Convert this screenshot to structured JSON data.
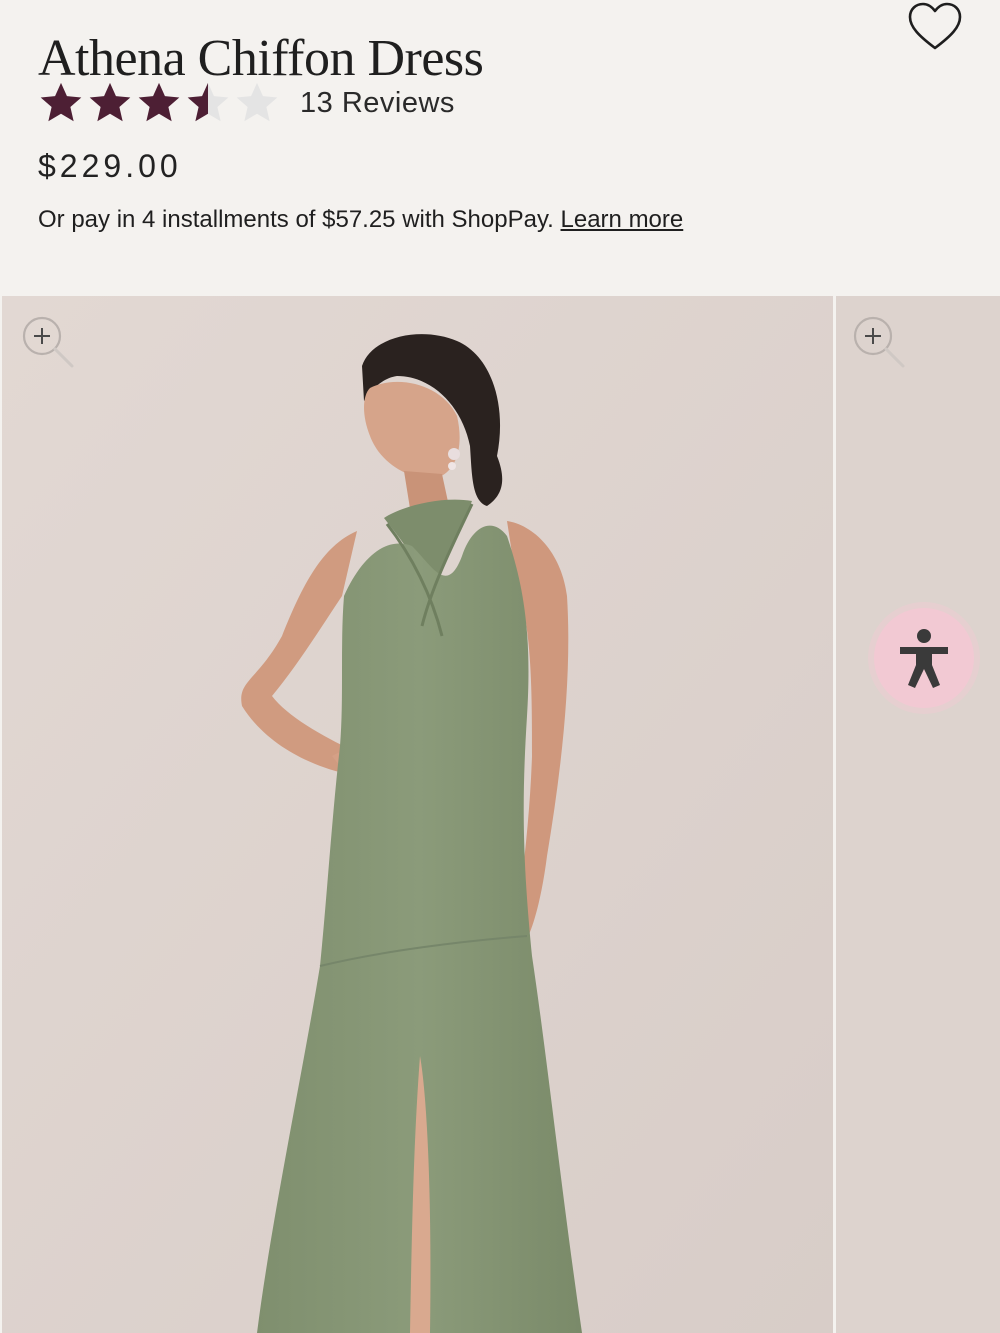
{
  "product": {
    "title": "Athena Chiffon Dress",
    "rating": 3.5,
    "rating_max": 5,
    "reviews_label": "13 Reviews",
    "price": "$229.00",
    "installments_text": "Or pay in 4 installments of $57.25 with ShopPay.",
    "learn_more_label": "Learn more"
  },
  "colors": {
    "background": "#f4f2ef",
    "star_filled": "#4d1f34",
    "star_empty": "#e4e4e4",
    "photo_backdrop": "#ddd3ce",
    "dress": "#8a9a78",
    "accessibility_button": "#f2c9d3"
  },
  "icons": {
    "wishlist": "heart-outline-icon",
    "zoom": "zoom-in-icon",
    "accessibility": "accessibility-person-icon"
  }
}
